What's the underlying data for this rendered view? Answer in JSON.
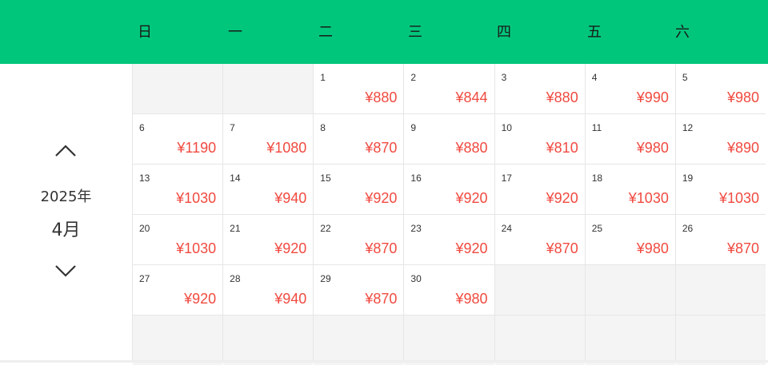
{
  "header": {
    "weekdays": [
      "日",
      "一",
      "二",
      "三",
      "四",
      "五",
      "六"
    ]
  },
  "nav": {
    "year": "2025年",
    "month": "4月",
    "prev_icon": "chevron-up-icon",
    "next_icon": "chevron-down-icon"
  },
  "calendar": {
    "leading_empty": 2,
    "total_cells": 42,
    "days": [
      {
        "day": "1",
        "price": "¥880"
      },
      {
        "day": "2",
        "price": "¥844"
      },
      {
        "day": "3",
        "price": "¥880"
      },
      {
        "day": "4",
        "price": "¥990"
      },
      {
        "day": "5",
        "price": "¥980"
      },
      {
        "day": "6",
        "price": "¥1190"
      },
      {
        "day": "7",
        "price": "¥1080"
      },
      {
        "day": "8",
        "price": "¥870"
      },
      {
        "day": "9",
        "price": "¥880"
      },
      {
        "day": "10",
        "price": "¥810"
      },
      {
        "day": "11",
        "price": "¥980"
      },
      {
        "day": "12",
        "price": "¥890"
      },
      {
        "day": "13",
        "price": "¥1030"
      },
      {
        "day": "14",
        "price": "¥940"
      },
      {
        "day": "15",
        "price": "¥920"
      },
      {
        "day": "16",
        "price": "¥920"
      },
      {
        "day": "17",
        "price": "¥920"
      },
      {
        "day": "18",
        "price": "¥1030"
      },
      {
        "day": "19",
        "price": "¥1030"
      },
      {
        "day": "20",
        "price": "¥1030"
      },
      {
        "day": "21",
        "price": "¥920"
      },
      {
        "day": "22",
        "price": "¥870"
      },
      {
        "day": "23",
        "price": "¥920"
      },
      {
        "day": "24",
        "price": "¥870"
      },
      {
        "day": "25",
        "price": "¥980"
      },
      {
        "day": "26",
        "price": "¥870"
      },
      {
        "day": "27",
        "price": "¥920"
      },
      {
        "day": "28",
        "price": "¥940"
      },
      {
        "day": "29",
        "price": "¥870"
      },
      {
        "day": "30",
        "price": "¥980"
      }
    ]
  },
  "colors": {
    "header_bg": "#00c67b",
    "price": "#f04a40",
    "empty_cell": "#f4f4f4"
  }
}
